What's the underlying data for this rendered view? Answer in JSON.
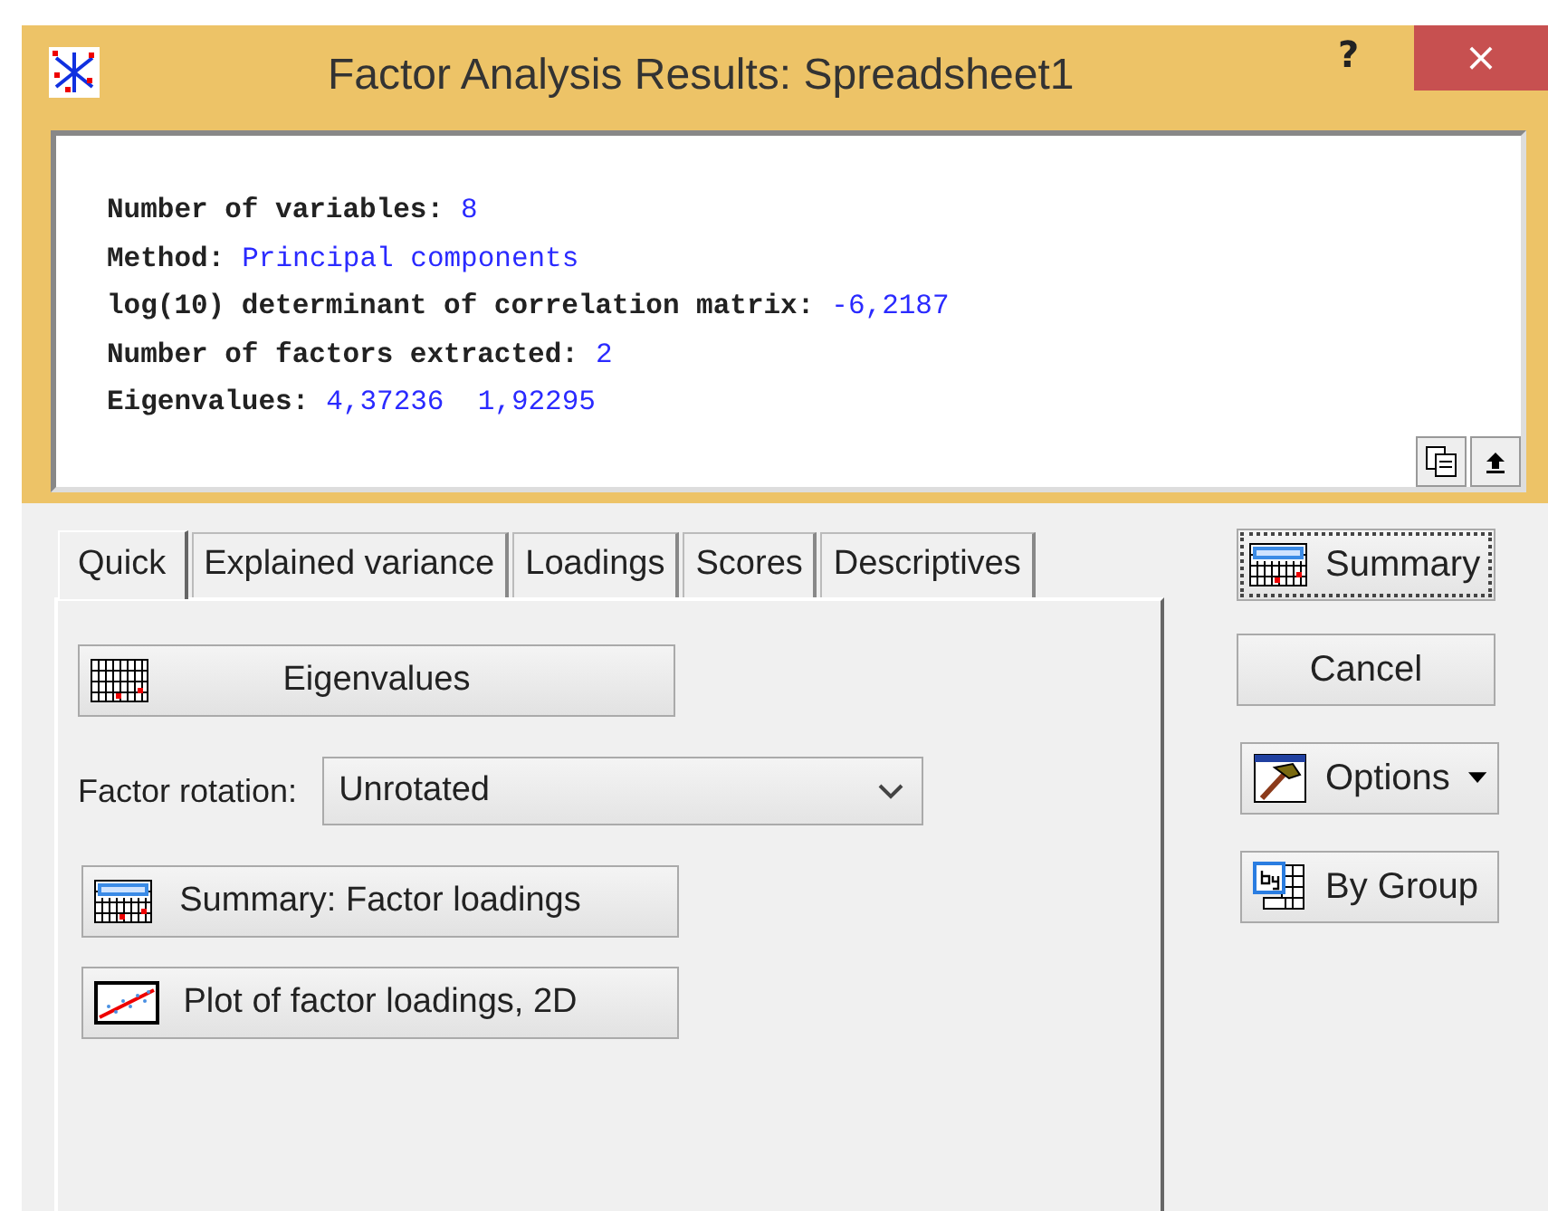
{
  "window": {
    "title": "Factor Analysis Results: Spreadsheet1",
    "help": "?",
    "close": "×"
  },
  "output": {
    "lines": [
      {
        "label": "Number of variables:",
        "value": "8"
      },
      {
        "label": "Method:",
        "value": "Principal components"
      },
      {
        "label": "log(10) determinant of correlation matrix:",
        "value": "-6,2187"
      },
      {
        "label": "Number of factors extracted:",
        "value": "2"
      },
      {
        "label": "Eigenvalues:",
        "value": "4,37236  1,92295"
      }
    ]
  },
  "tabs": [
    {
      "label": "Quick",
      "selected": true
    },
    {
      "label": "Explained variance",
      "selected": false
    },
    {
      "label": "Loadings",
      "selected": false
    },
    {
      "label": "Scores",
      "selected": false
    },
    {
      "label": "Descriptives",
      "selected": false
    }
  ],
  "quick": {
    "items": [
      {
        "kind": "button",
        "label": "Eigenvalues"
      },
      {
        "kind": "select",
        "label": "Factor rotation:",
        "value": "Unrotated"
      },
      {
        "kind": "button",
        "label": "Summary: Factor loadings"
      },
      {
        "kind": "button",
        "label": "Plot of factor loadings, 2D"
      }
    ]
  },
  "side_buttons": [
    {
      "label": "Summary",
      "focused": true,
      "dropdown": false
    },
    {
      "label": "Cancel",
      "focused": false,
      "dropdown": false
    },
    {
      "label": "Options",
      "focused": false,
      "dropdown": true
    },
    {
      "label": "By Group",
      "focused": false,
      "dropdown": false
    }
  ]
}
